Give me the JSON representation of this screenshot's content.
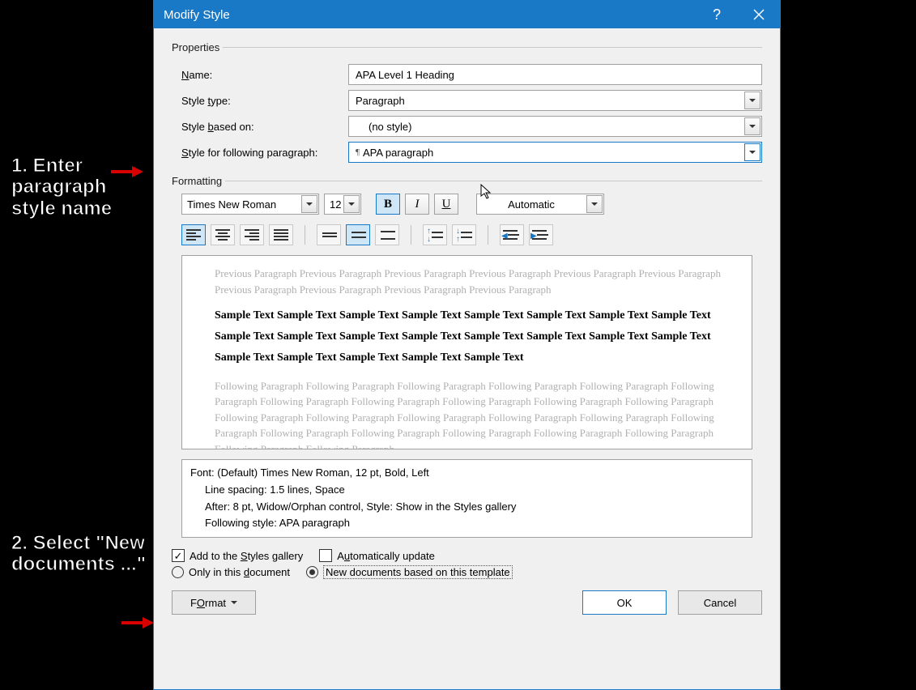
{
  "titlebar": {
    "title": "Modify Style",
    "help": "?"
  },
  "properties": {
    "section": "Properties",
    "name": {
      "label": "Name:",
      "access": "N",
      "value": "APA Level 1 Heading"
    },
    "type": {
      "label": "Style type:",
      "access": "t",
      "value": "Paragraph"
    },
    "based": {
      "label": "Style based on:",
      "access": "b",
      "value": "(no style)"
    },
    "following": {
      "label": "Style for following paragraph:",
      "access": "S",
      "value": "APA paragraph"
    }
  },
  "formatting": {
    "section": "Formatting",
    "font": "Times New Roman",
    "size": "12",
    "bold": "B",
    "italic": "I",
    "underline": "U",
    "color": "Automatic"
  },
  "preview": {
    "previous": "Previous Paragraph Previous Paragraph Previous Paragraph Previous Paragraph Previous Paragraph Previous Paragraph Previous Paragraph Previous Paragraph Previous Paragraph Previous Paragraph",
    "sample": "Sample Text Sample Text Sample Text Sample Text Sample Text Sample Text Sample Text Sample Text Sample Text Sample Text Sample Text Sample Text Sample Text Sample Text Sample Text Sample Text Sample Text Sample Text Sample Text Sample Text Sample Text",
    "following": "Following Paragraph Following Paragraph Following Paragraph Following Paragraph Following Paragraph Following Paragraph Following Paragraph Following Paragraph Following Paragraph Following Paragraph Following Paragraph Following Paragraph Following Paragraph Following Paragraph Following Paragraph Following Paragraph Following Paragraph Following Paragraph Following Paragraph Following Paragraph Following Paragraph Following Paragraph Following Paragraph Following Paragraph"
  },
  "description": {
    "line1": "Font: (Default) Times New Roman, 12 pt, Bold, Left",
    "line2": "Line spacing:  1.5 lines, Space",
    "line3": "After:  8 pt, Widow/Orphan control, Style: Show in the Styles gallery",
    "line4": "Following style: APA paragraph"
  },
  "options": {
    "add_gallery": "Add to the Styles gallery",
    "add_gallery_access": "S",
    "auto_update": "Automatically update",
    "auto_update_access": "u",
    "only_doc": "Only in this document",
    "only_doc_access": "d",
    "new_docs": "New documents based on this template"
  },
  "buttons": {
    "format": "Format",
    "format_access": "O",
    "ok": "OK",
    "cancel": "Cancel"
  },
  "annotations": {
    "c1": "1. Enter paragraph style name",
    "c2": "2. Select \"New documents ...\""
  }
}
